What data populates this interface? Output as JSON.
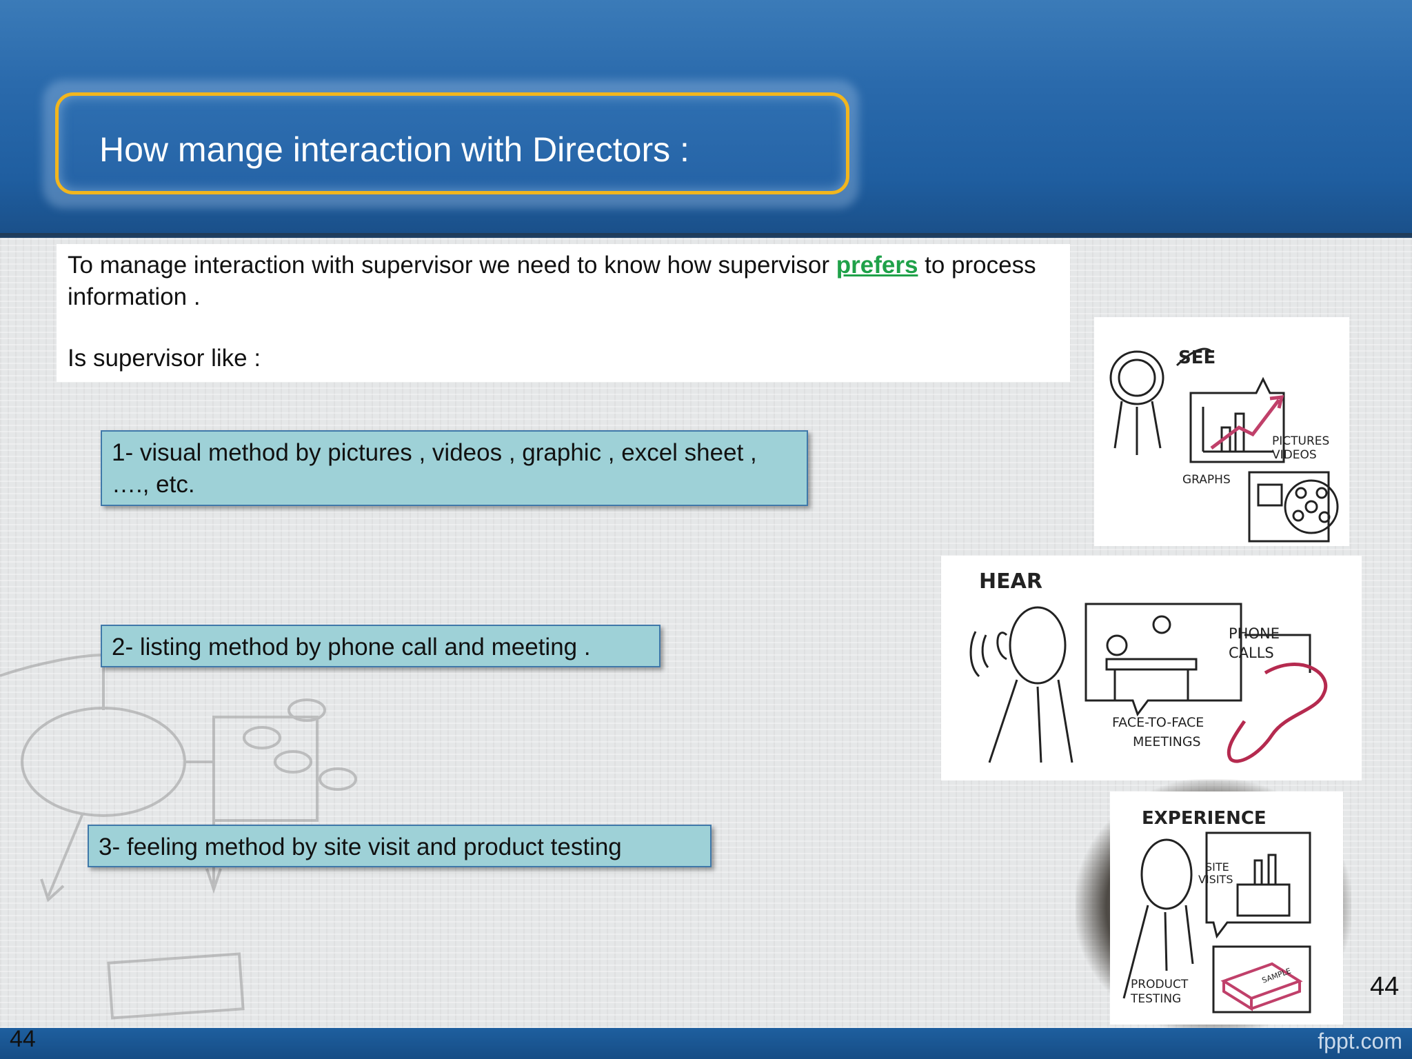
{
  "slide": {
    "title": "How mange interaction with Directors :",
    "intro": {
      "before": "To manage interaction with supervisor we need to know how supervisor ",
      "highlight": "prefers",
      "after": " to process information .",
      "question": "Is supervisor like :"
    },
    "methods": [
      {
        "label": "1- visual  method by pictures , videos , graphic , excel sheet , …., etc."
      },
      {
        "label": "2- listing method by phone call and  meeting ."
      },
      {
        "label": "3- feeling method by site visit and  product testing"
      }
    ],
    "illustrations": {
      "see": {
        "heading": "SEE",
        "labels": [
          "PICTURES",
          "VIDEOS",
          "GRAPHS"
        ]
      },
      "hear": {
        "heading": "HEAR",
        "labels": [
          "PHONE",
          "CALLS",
          "FACE-TO-FACE",
          "MEETINGS"
        ]
      },
      "experience": {
        "heading": "EXPERIENCE",
        "labels": [
          "SITE",
          "VISITS",
          "PRODUCT",
          "TESTING",
          "SAMPLE"
        ]
      }
    },
    "slide_number": "44",
    "brand": "fppt.com"
  },
  "colors": {
    "header": "#2a6aac",
    "title_border": "#f2b61e",
    "method_fill": "#9ed1d7",
    "highlight": "#1fa149"
  }
}
